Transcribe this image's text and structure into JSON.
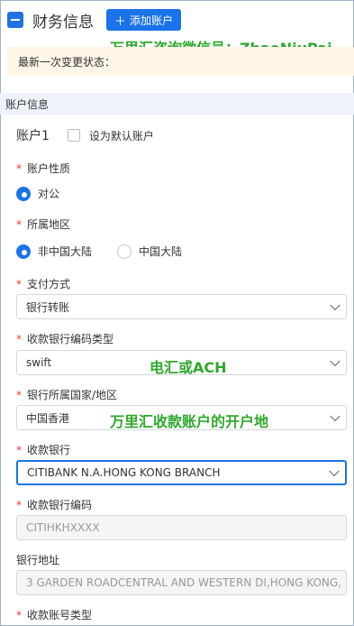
{
  "header": {
    "title": "财务信息",
    "add_button": "添加账户",
    "add_icon": "plus-icon"
  },
  "overlays": {
    "wechat": "万里汇咨询微信号：ZhaoNiuPai",
    "wire": "电汇或ACH",
    "receiving_location": "万里汇收款账户的开户地"
  },
  "status": {
    "label": "最新一次变更状态："
  },
  "section": {
    "title": "账户信息"
  },
  "account": {
    "name": "账户1",
    "default_label": "设为默认账户",
    "default_checked": false
  },
  "form": {
    "account_type": {
      "label": "账户性质",
      "required": true,
      "options": [
        "对公"
      ],
      "selected": "对公"
    },
    "region": {
      "label": "所属地区",
      "required": true,
      "options": [
        "非中国大陆",
        "中国大陆"
      ],
      "selected": "非中国大陆"
    },
    "payment_method": {
      "label": "支付方式",
      "required": true,
      "value": "银行转账"
    },
    "bank_code_type": {
      "label": "收款银行编码类型",
      "required": true,
      "value": "swift"
    },
    "bank_country": {
      "label": "银行所属国家/地区",
      "required": true,
      "value": "中国香港"
    },
    "bank": {
      "label": "收款银行",
      "required": true,
      "value": "CITIBANK N.A.HONG KONG BRANCH"
    },
    "bank_code": {
      "label": "收款银行编码",
      "required": true,
      "value": "CITIHKHXXXX"
    },
    "bank_address": {
      "label": "银行地址",
      "required": false,
      "value": "3 GARDEN ROADCENTRAL AND WESTERN DI,HONG KONG, HONG KONG"
    },
    "account_number_type": {
      "label": "收款账号类型",
      "required": true
    }
  },
  "colors": {
    "primary": "#1a73e8",
    "required": "#e53935",
    "overlay_text": "#2fa82c",
    "status_bg": "#fff6e8",
    "section_bg": "#eef3fa"
  }
}
